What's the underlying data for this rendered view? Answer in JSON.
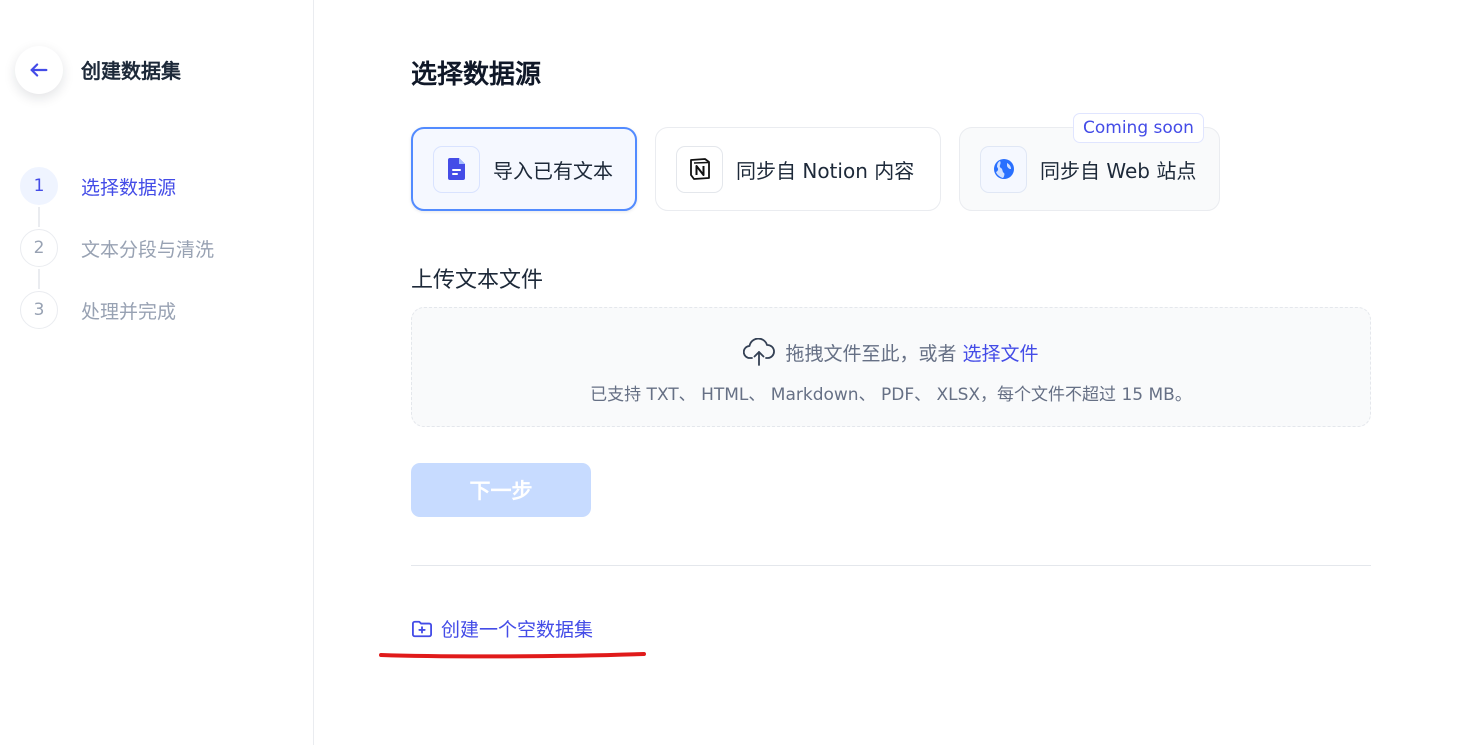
{
  "sidebar": {
    "title": "创建数据集",
    "steps": [
      {
        "num": "1",
        "label": "选择数据源"
      },
      {
        "num": "2",
        "label": "文本分段与清洗"
      },
      {
        "num": "3",
        "label": "处理并完成"
      }
    ]
  },
  "main": {
    "title": "选择数据源",
    "sources": [
      {
        "label": "导入已有文本",
        "icon": "document-icon"
      },
      {
        "label": "同步自 Notion 内容",
        "icon": "notion-icon"
      },
      {
        "label": "同步自 Web 站点",
        "icon": "globe-icon"
      }
    ],
    "coming_soon": "Coming soon",
    "upload_title": "上传文本文件",
    "dropzone": {
      "text": "拖拽文件至此，或者",
      "link": "选择文件",
      "tip": "已支持 TXT、 HTML、 Markdown、 PDF、 XLSX，每个文件不超过 15 MB。"
    },
    "next_button": "下一步",
    "create_empty": "创建一个空数据集"
  },
  "colors": {
    "accent": "#444ce7",
    "active_border": "#528bff",
    "next_disabled": "#c7dbff",
    "annotation": "#e01b1b"
  }
}
